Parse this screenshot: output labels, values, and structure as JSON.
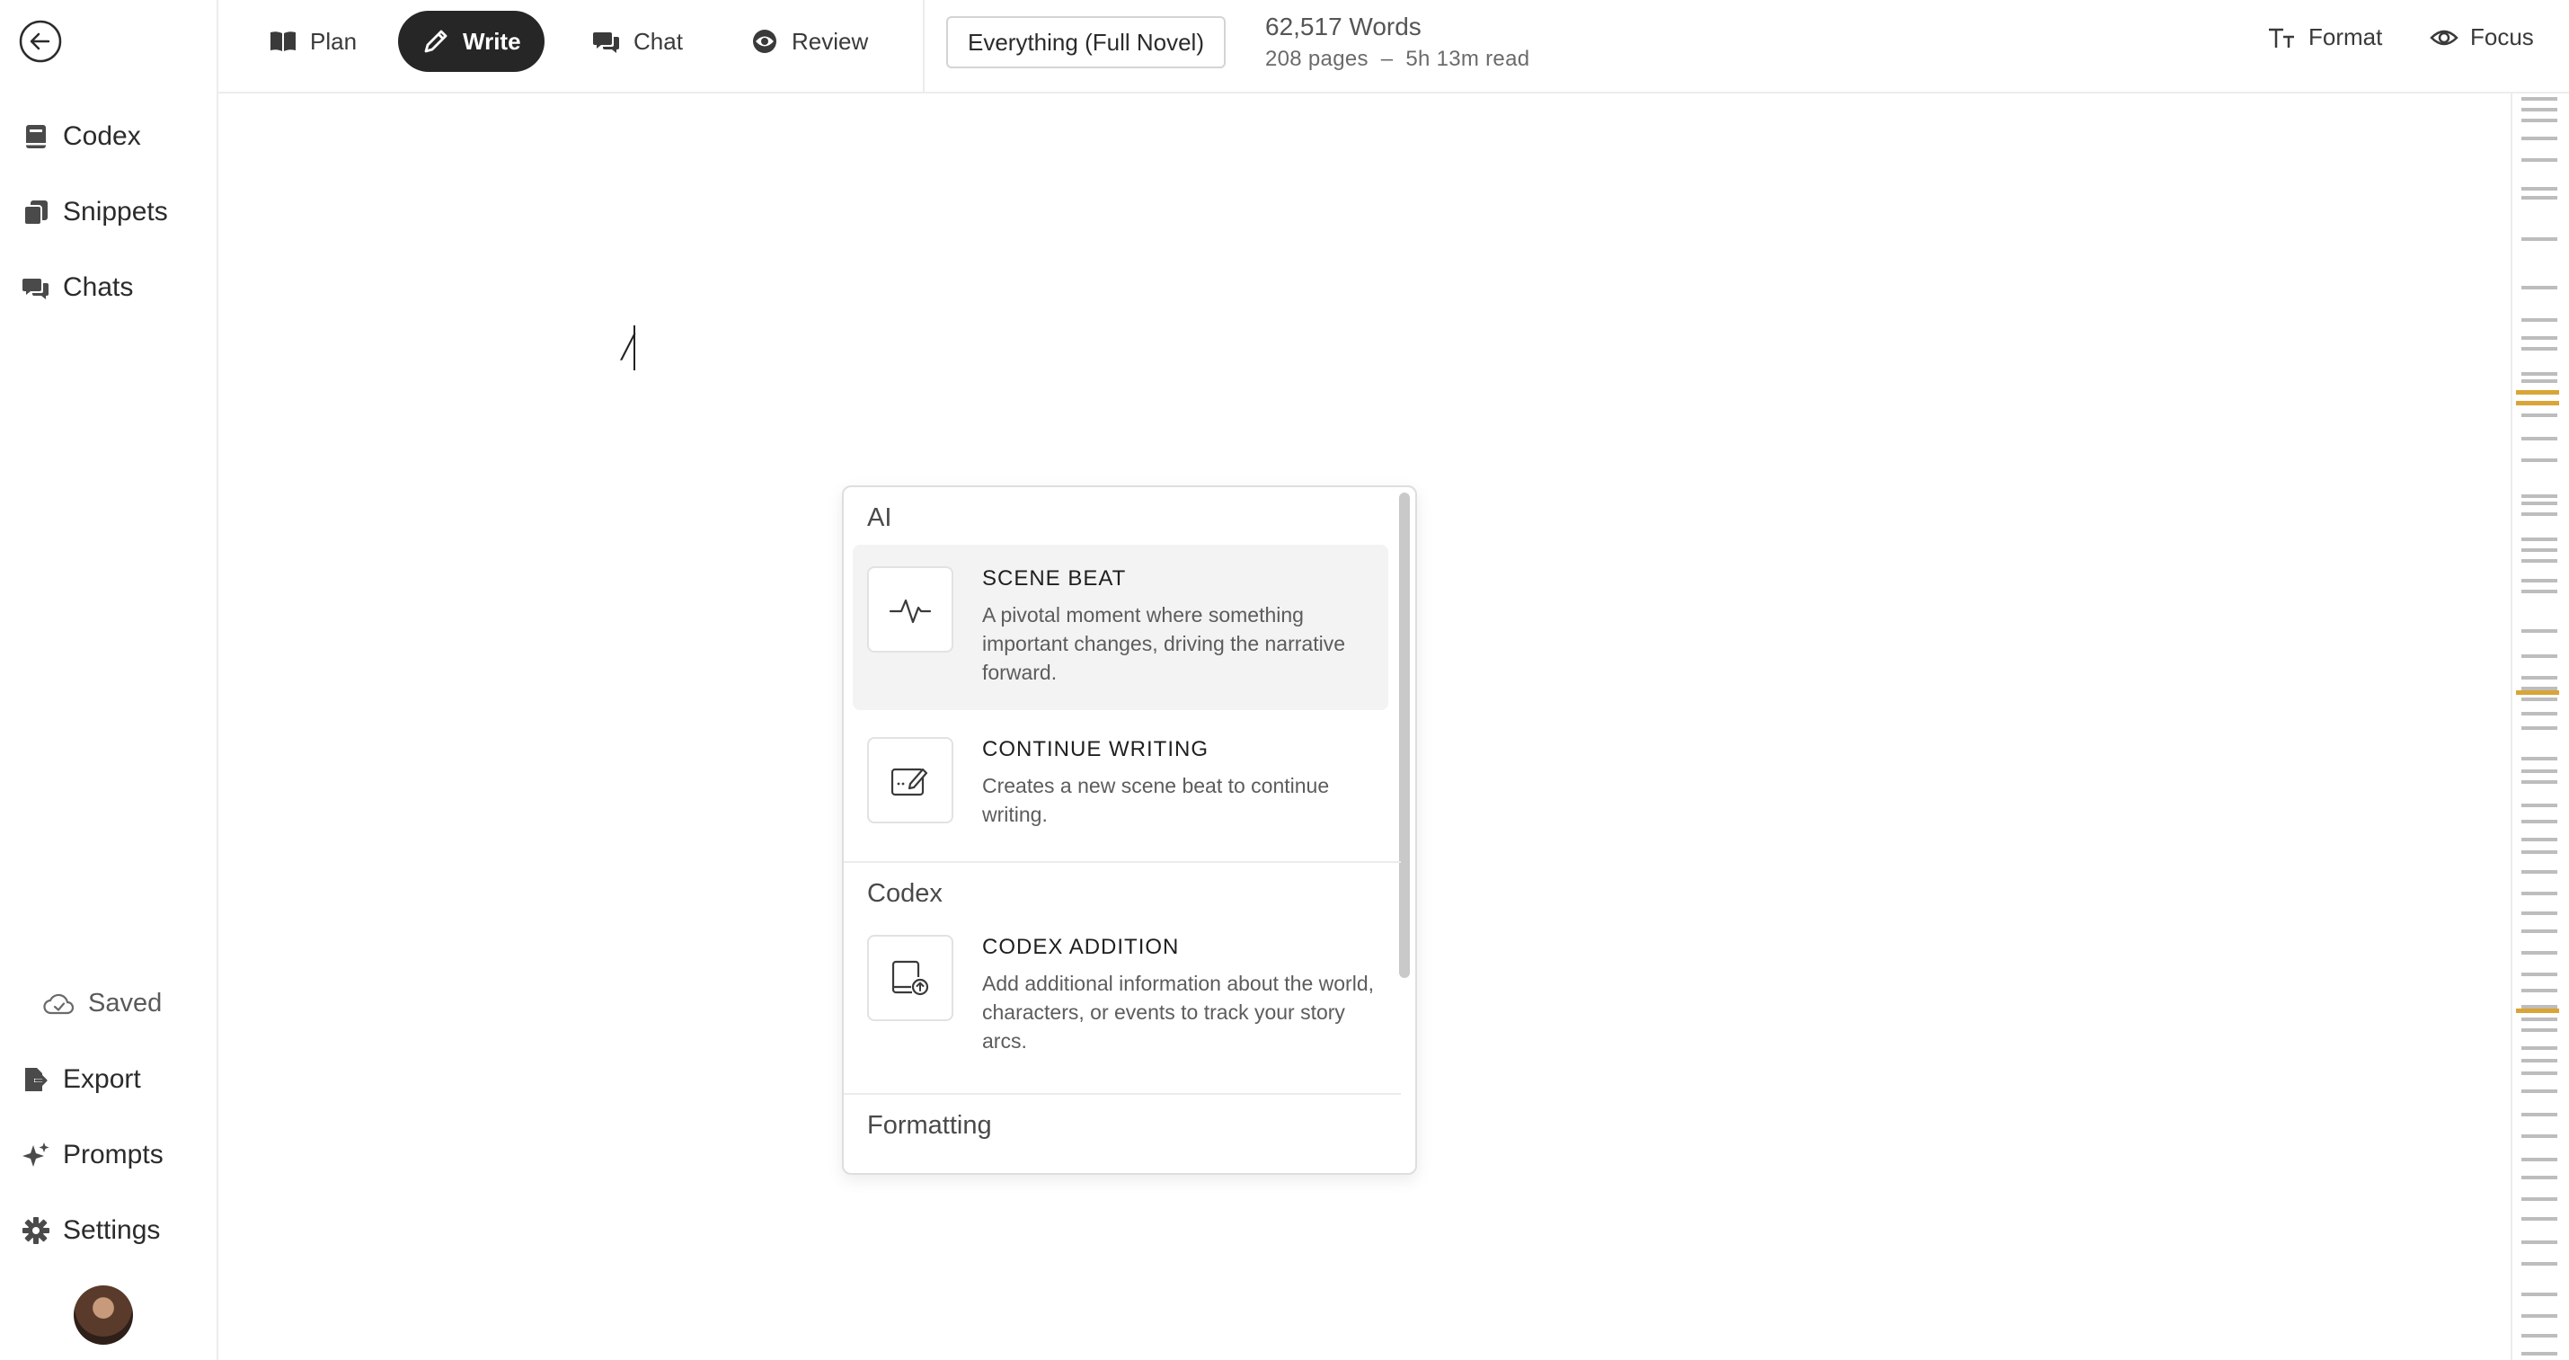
{
  "sidebar": {
    "back_icon": "arrow-left-circle-icon",
    "top_items": [
      {
        "label": "Codex",
        "icon": "book-icon"
      },
      {
        "label": "Snippets",
        "icon": "copy-icon"
      },
      {
        "label": "Chats",
        "icon": "chat-bubbles-icon"
      }
    ],
    "saved_label": "Saved",
    "bottom_items": [
      {
        "label": "Export",
        "icon": "file-export-icon"
      },
      {
        "label": "Prompts",
        "icon": "sparkles-icon"
      },
      {
        "label": "Settings",
        "icon": "gear-icon"
      }
    ]
  },
  "topbar": {
    "tabs": [
      {
        "label": "Plan",
        "icon": "open-book-icon",
        "active": false
      },
      {
        "label": "Write",
        "icon": "pencil-icon",
        "active": true
      },
      {
        "label": "Chat",
        "icon": "chat-bubbles-icon",
        "active": false
      },
      {
        "label": "Review",
        "icon": "eye-icon",
        "active": false
      }
    ],
    "scope": "Everything (Full Novel)",
    "word_count": "62,517 Words",
    "page_stats": "208 pages  –  5h 13m read",
    "format_label": "Format",
    "focus_label": "Focus"
  },
  "editor": {
    "typed_text": "/"
  },
  "slash_menu": {
    "sections": [
      {
        "title": "AI",
        "items": [
          {
            "title": "SCENE BEAT",
            "description": "A pivotal moment where something important changes, driving the narrative forward.",
            "icon": "pulse-icon"
          },
          {
            "title": "CONTINUE WRITING",
            "description": "Creates a new scene beat to continue writing.",
            "icon": "edit-square-icon"
          }
        ]
      },
      {
        "title": "Codex",
        "items": [
          {
            "title": "CODEX ADDITION",
            "description": "Add additional information about the world, characters, or events to track your story arcs.",
            "icon": "document-upload-icon"
          }
        ]
      },
      {
        "title": "Formatting",
        "items": []
      }
    ]
  },
  "colors": {
    "active_tab_bg": "#262626",
    "minimap_highlight": "#d9a536",
    "menu_highlight": "#f3f3f3"
  }
}
